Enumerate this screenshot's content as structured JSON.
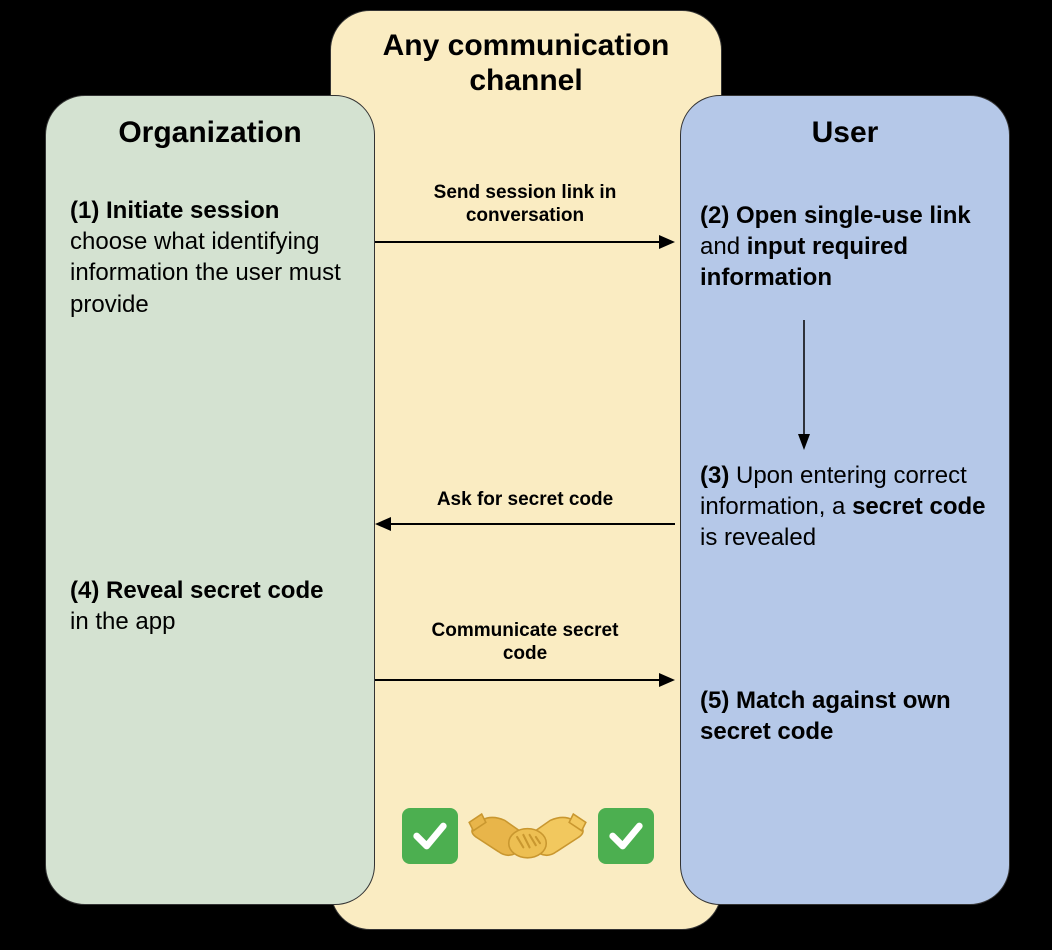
{
  "titles": {
    "middle": "Any communication channel",
    "left": "Organization",
    "right": "User"
  },
  "steps": {
    "s1_bold": "(1) Initiate session",
    "s1_rest": "choose what identifying information the user must provide",
    "s2_pre": "(2) Open single-use link",
    "s2_mid": " and ",
    "s2_post": "input required information",
    "s3_pre": "(3) ",
    "s3_mid": "Upon entering correct information, a ",
    "s3_bold": "secret code",
    "s3_end": " is revealed",
    "s4_bold": "(4) Reveal secret code",
    "s4_rest": " in the app",
    "s5": "(5) Match against own secret code"
  },
  "arrows": {
    "a1": "Send session link in conversation",
    "a2": "Ask for secret code",
    "a3": "Communicate secret code"
  },
  "icons": {
    "check_left": "checkmark-icon",
    "check_right": "checkmark-icon",
    "handshake": "handshake-icon"
  }
}
